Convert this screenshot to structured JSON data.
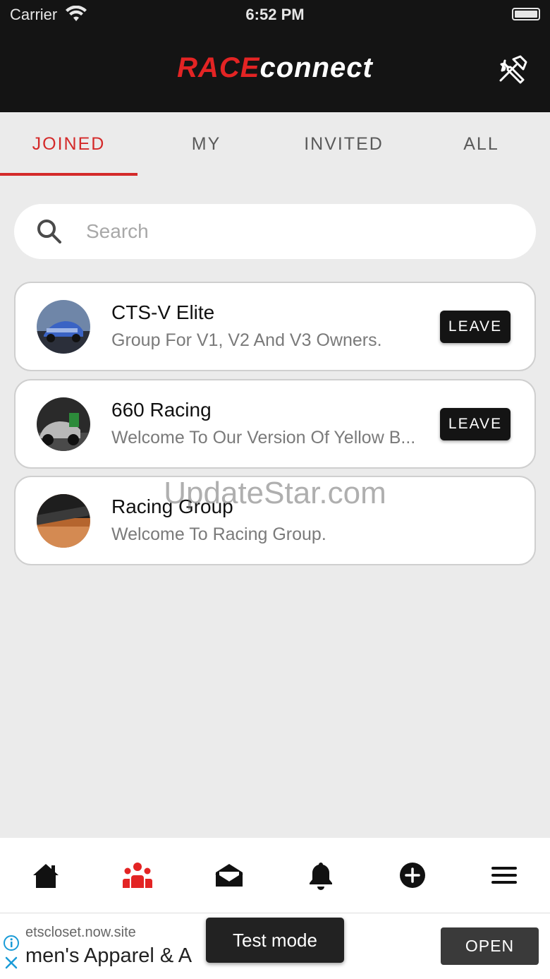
{
  "status_bar": {
    "carrier": "Carrier",
    "time": "6:52 PM"
  },
  "header": {
    "logo_race": "RACE",
    "logo_connect": "connect",
    "tools_icon": "tools-icon"
  },
  "tabs": [
    {
      "label": "JOINED",
      "active": true
    },
    {
      "label": "MY",
      "active": false
    },
    {
      "label": "INVITED",
      "active": false
    },
    {
      "label": "ALL",
      "active": false
    }
  ],
  "search": {
    "placeholder": "Search",
    "value": ""
  },
  "groups": [
    {
      "name": "CTS-V Elite",
      "description": "Group For V1, V2 And V3 Owners.",
      "action": "LEAVE"
    },
    {
      "name": "660 Racing",
      "description": "Welcome To Our Version Of Yellow B...",
      "action": "LEAVE"
    },
    {
      "name": "Racing Group",
      "description": "Welcome To Racing Group.",
      "action": ""
    }
  ],
  "watermark": "UpdateStar.com",
  "bottom_nav": [
    {
      "icon": "home-icon",
      "active": false
    },
    {
      "icon": "groups-icon",
      "active": true
    },
    {
      "icon": "messages-icon",
      "active": false
    },
    {
      "icon": "bell-icon",
      "active": false
    },
    {
      "icon": "add-icon",
      "active": false
    },
    {
      "icon": "menu-icon",
      "active": false
    }
  ],
  "ad": {
    "url": "etscloset.now.site",
    "text": "men's Apparel & A",
    "open_label": "OPEN",
    "test_mode_label": "Test mode"
  },
  "colors": {
    "accent": "#d42a2a",
    "header_bg": "#141414",
    "page_bg": "#ebebeb"
  }
}
